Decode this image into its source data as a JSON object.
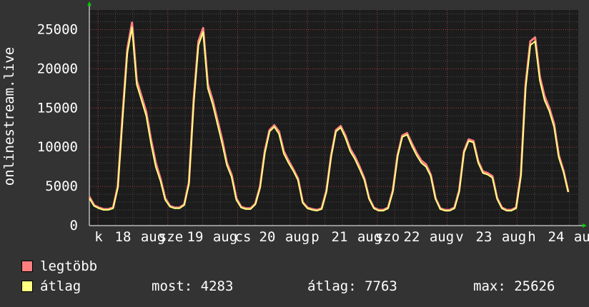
{
  "chart_data": {
    "type": "line",
    "ylabel": "onlinestream.live",
    "ylim": [
      0,
      27500
    ],
    "yticks": [
      0,
      5000,
      10000,
      15000,
      20000,
      25000
    ],
    "x_labels": [
      "k 18 aug",
      "sze 19 aug",
      "cs 20 aug",
      "p 21 aug",
      "szo 22 aug",
      "v 23 aug",
      "h 24 aug"
    ],
    "x_label_texts": [
      "k",
      "18",
      "aug",
      "sze",
      "19",
      "aug",
      "cs",
      "20",
      "aug",
      "p",
      "21",
      "aug",
      "szo",
      "22",
      "aug",
      "v",
      "23",
      "aug",
      "h",
      "24",
      "aug"
    ],
    "series": [
      {
        "name": "legtöbb",
        "color": "#ff7f7f",
        "values": [
          3700,
          2600,
          2300,
          2100,
          2100,
          2300,
          5000,
          14000,
          22500,
          25900,
          18500,
          16500,
          14500,
          11000,
          8000,
          6000,
          3500,
          2500,
          2300,
          2300,
          2700,
          5500,
          16000,
          23500,
          25200,
          18000,
          16000,
          13500,
          11000,
          8000,
          6500,
          3500,
          2400,
          2200,
          2200,
          2800,
          5000,
          9500,
          12200,
          12800,
          12000,
          9500,
          8300,
          7200,
          6000,
          3000,
          2300,
          2100,
          2000,
          2200,
          4500,
          9000,
          12200,
          12700,
          11500,
          9800,
          8800,
          7500,
          6000,
          3500,
          2300,
          2000,
          2000,
          2300,
          4500,
          9000,
          11500,
          11800,
          10500,
          9300,
          8300,
          7800,
          6500,
          3500,
          2200,
          2000,
          2000,
          2300,
          4500,
          9500,
          11000,
          10800,
          8200,
          6900,
          6700,
          6300,
          3500,
          2300,
          2000,
          2000,
          2300,
          6500,
          18000,
          23500,
          24000,
          19000,
          16500,
          15000,
          13000,
          9000,
          7000,
          4300
        ]
      },
      {
        "name": "átlag",
        "color": "#ffff80",
        "values": [
          3500,
          2500,
          2200,
          2000,
          2000,
          2200,
          4800,
          13500,
          22000,
          25300,
          18000,
          16000,
          14000,
          10500,
          7500,
          5700,
          3300,
          2400,
          2200,
          2200,
          2600,
          5300,
          15500,
          23000,
          24700,
          17500,
          15500,
          13000,
          10500,
          7700,
          6200,
          3300,
          2300,
          2100,
          2100,
          2700,
          4800,
          9200,
          12000,
          12600,
          11700,
          9200,
          8000,
          7000,
          5800,
          2900,
          2200,
          2000,
          1900,
          2100,
          4300,
          8800,
          12000,
          12500,
          11200,
          9500,
          8500,
          7200,
          5800,
          3400,
          2200,
          1900,
          1900,
          2200,
          4300,
          8800,
          11300,
          11600,
          10200,
          9000,
          8000,
          7500,
          6300,
          3400,
          2100,
          1900,
          1900,
          2200,
          4300,
          9300,
          10800,
          10600,
          8000,
          6700,
          6500,
          6100,
          3400,
          2200,
          1900,
          1900,
          2200,
          6300,
          17500,
          23000,
          23500,
          18500,
          16000,
          14600,
          12600,
          8700,
          6800,
          4283
        ]
      }
    ],
    "grid": true
  },
  "legend": {
    "items": [
      {
        "label": "legtöbb",
        "color": "#ff7f7f"
      },
      {
        "label": "átlag",
        "color": "#ffff80"
      }
    ]
  },
  "stats": {
    "now": "most: 4283",
    "avg": "átlag: 7763",
    "max": "max: 25626"
  }
}
